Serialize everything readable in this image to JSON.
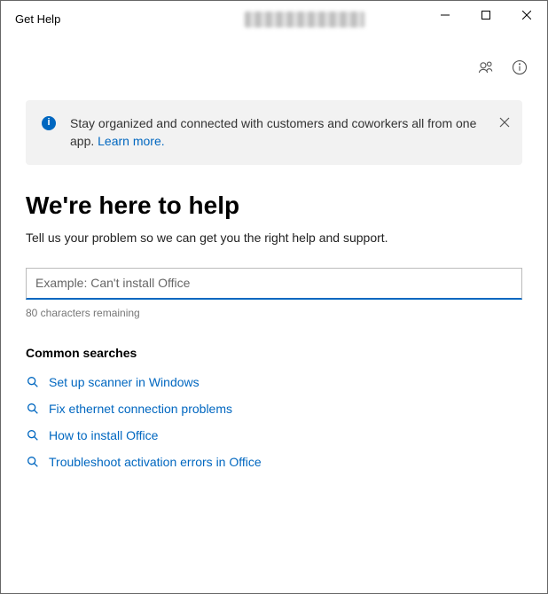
{
  "window": {
    "title": "Get Help"
  },
  "banner": {
    "text": "Stay organized and connected with customers and coworkers all from one app. ",
    "link": "Learn more."
  },
  "heading": "We're here to help",
  "subheading": "Tell us your problem so we can get you the right help and support.",
  "search": {
    "placeholder": "Example: Can't install Office",
    "counter": "80 characters remaining"
  },
  "common": {
    "title": "Common searches",
    "items": [
      "Set up scanner in Windows",
      "Fix ethernet connection problems",
      "How to install Office",
      "Troubleshoot activation errors in Office"
    ]
  }
}
